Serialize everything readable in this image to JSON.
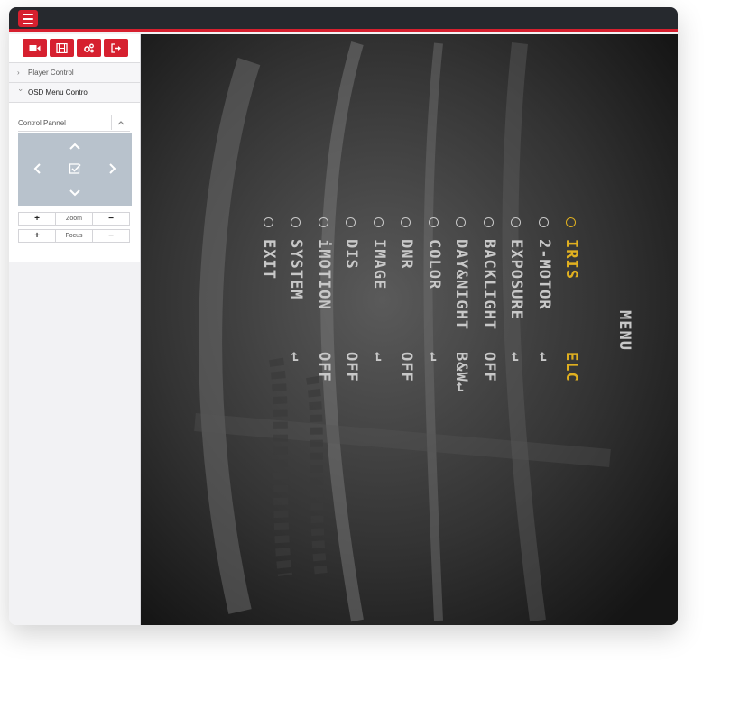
{
  "topbar": {
    "menu_icon": "hamburger-icon"
  },
  "toolbar": {
    "buttons": [
      {
        "icon": "video-camera-icon"
      },
      {
        "icon": "film-icon"
      },
      {
        "icon": "settings-gears-icon"
      },
      {
        "icon": "logout-icon"
      }
    ]
  },
  "sidebar": {
    "player_control": "Player Control",
    "osd_menu_control": "OSD Menu Control",
    "control_panel": "Control Pannel",
    "zoom_label": "Zoom",
    "focus_label": "Focus",
    "plus": "+",
    "minus": "−"
  },
  "osd": {
    "title": "MENU",
    "items": [
      {
        "label": "IRIS",
        "value": "ELC",
        "highlight": true
      },
      {
        "label": "2-MOTOR",
        "value": "↵",
        "highlight": false
      },
      {
        "label": "EXPOSURE",
        "value": "↵",
        "highlight": false
      },
      {
        "label": "BACKLIGHT",
        "value": "OFF",
        "highlight": false
      },
      {
        "label": "DAY&NIGHT",
        "value": "B&W↵",
        "highlight": false
      },
      {
        "label": "COLOR",
        "value": "↵",
        "highlight": false
      },
      {
        "label": "DNR",
        "value": "OFF",
        "highlight": false
      },
      {
        "label": "IMAGE",
        "value": "↵",
        "highlight": false
      },
      {
        "label": "DIS",
        "value": "OFF",
        "highlight": false
      },
      {
        "label": "iMOTION",
        "value": "OFF",
        "highlight": false
      },
      {
        "label": "SYSTEM",
        "value": "↵",
        "highlight": false
      },
      {
        "label": "EXIT",
        "value": "",
        "highlight": false
      }
    ]
  },
  "colors": {
    "accent": "#d6202f",
    "osd_highlight": "#e0b020",
    "osd_text": "#c8c8c8"
  }
}
